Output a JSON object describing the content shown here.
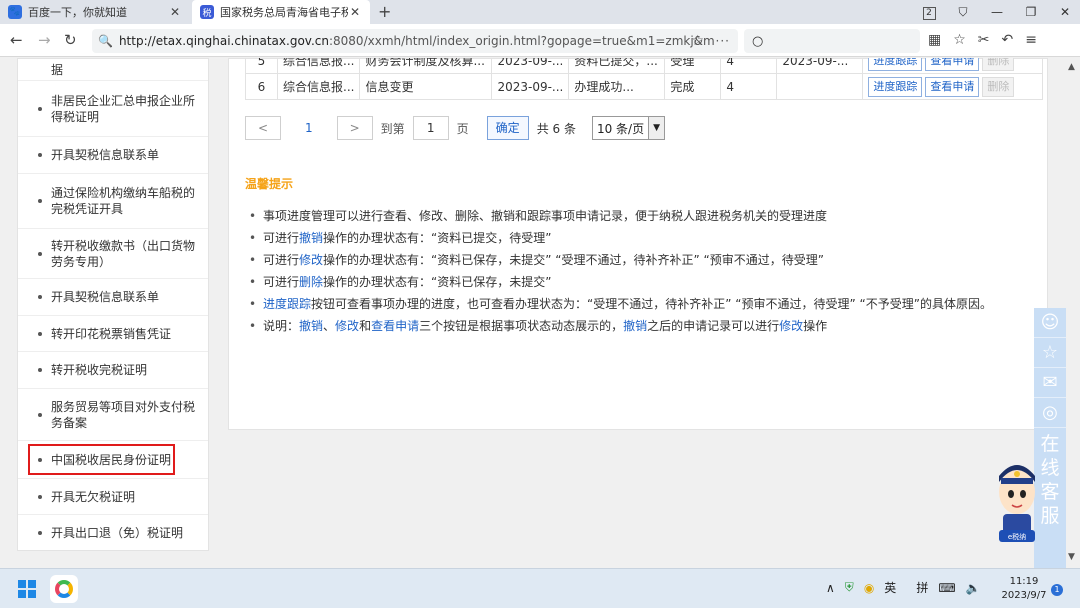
{
  "tabs": [
    {
      "title": "百度一下，你就知道",
      "icon": "baidu-paw-icon"
    },
    {
      "title": "国家税务总局青海省电子税务",
      "icon": "tax-bureau-icon"
    }
  ],
  "window": {
    "tab_count": "2"
  },
  "address": {
    "url_host": "http://etax.qinghai.chinatax.gov.cn",
    "url_rest": ":8080/xxmh/html/index_origin.html?gopage=true&m1=zmkj&m",
    "more": "···"
  },
  "sidebar": {
    "items": [
      {
        "label": "据"
      },
      {
        "label": "非居民企业汇总申报企业所得税证明"
      },
      {
        "label": "开具契税信息联系单"
      },
      {
        "label": "通过保险机构缴纳车船税的完税凭证开具"
      },
      {
        "label": "转开税收缴款书（出口货物劳务专用）"
      },
      {
        "label": "开具契税信息联系单"
      },
      {
        "label": "转开印花税票销售凭证"
      },
      {
        "label": "转开税收完税证明"
      },
      {
        "label": "服务贸易等项目对外支付税务备案"
      },
      {
        "label": "中国税收居民身份证明"
      },
      {
        "label": "开具无欠税证明"
      },
      {
        "label": "开具出口退（免）税证明"
      }
    ]
  },
  "table": {
    "rows": [
      {
        "no": "5",
        "type": "综合信息报...",
        "item": "财务会计制度及核算...",
        "date": "2023-09-...",
        "status": "资料已提交，...",
        "result": "受理",
        "level": "4",
        "date2": "2023-09-...",
        "actions": [
          "进度跟踪",
          "查看申请",
          "删除"
        ]
      },
      {
        "no": "6",
        "type": "综合信息报...",
        "item": "信息变更",
        "date": "2023-09-...",
        "status": "办理成功...",
        "result": "完成",
        "level": "4",
        "date2": "",
        "actions": [
          "进度跟踪",
          "查看申请",
          "删除"
        ]
      }
    ]
  },
  "pager": {
    "prev": "<",
    "current_page": "1",
    "next": ">",
    "goto_label": "到第",
    "goto_value": "1",
    "page_unit": "页",
    "confirm": "确定",
    "total": "共 6 条",
    "page_size": "10 条/页"
  },
  "tips": {
    "title": "温馨提示",
    "items": [
      [
        {
          "t": "事项进度管理可以进行查看、修改、删除、撤销和跟踪事项申请记录，便于纳税人跟进税务机关的受理进度"
        }
      ],
      [
        {
          "t": "可进行"
        },
        {
          "t": "撤销",
          "link": true
        },
        {
          "t": "操作的办理状态有：“资料已提交，待受理”"
        }
      ],
      [
        {
          "t": "可进行"
        },
        {
          "t": "修改",
          "link": true
        },
        {
          "t": "操作的办理状态有：“资料已保存，未提交”  “受理不通过，待补齐补正”  “预审不通过，待受理”"
        }
      ],
      [
        {
          "t": "可进行"
        },
        {
          "t": "删除",
          "link": true
        },
        {
          "t": "操作的办理状态有：“资料已保存，未提交”"
        }
      ],
      [
        {
          "t": "进度跟踪",
          "link": true
        },
        {
          "t": "按钮可查看事项办理的进度，也可查看办理状态为：“受理不通过，待补齐补正”  “预审不通过，待受理”  “不予受理”的具体原因。"
        }
      ],
      [
        {
          "t": "说明："
        },
        {
          "t": "撤销",
          "link": true
        },
        {
          "t": "、"
        },
        {
          "t": "修改",
          "link": true
        },
        {
          "t": "和"
        },
        {
          "t": "查看申请",
          "link": true
        },
        {
          "t": "三个按钮是根据事项状态动态展示的，"
        },
        {
          "t": "撤销",
          "link": true
        },
        {
          "t": "之后的申请记录可以进行"
        },
        {
          "t": "修改",
          "link": true
        },
        {
          "t": "操作"
        }
      ]
    ]
  },
  "float_bar": {
    "service_text": "在线客服",
    "mascot_badge": "e税纳"
  },
  "taskbar": {
    "lang": "英",
    "ime": "拼",
    "time": "11:19",
    "date": "2023/9/7",
    "notifications": "1"
  },
  "colors": {
    "link": "#1f63c7",
    "tip_title": "#f5a319",
    "highlight_box": "#e01b1b",
    "float_bar": "#c9def5"
  }
}
